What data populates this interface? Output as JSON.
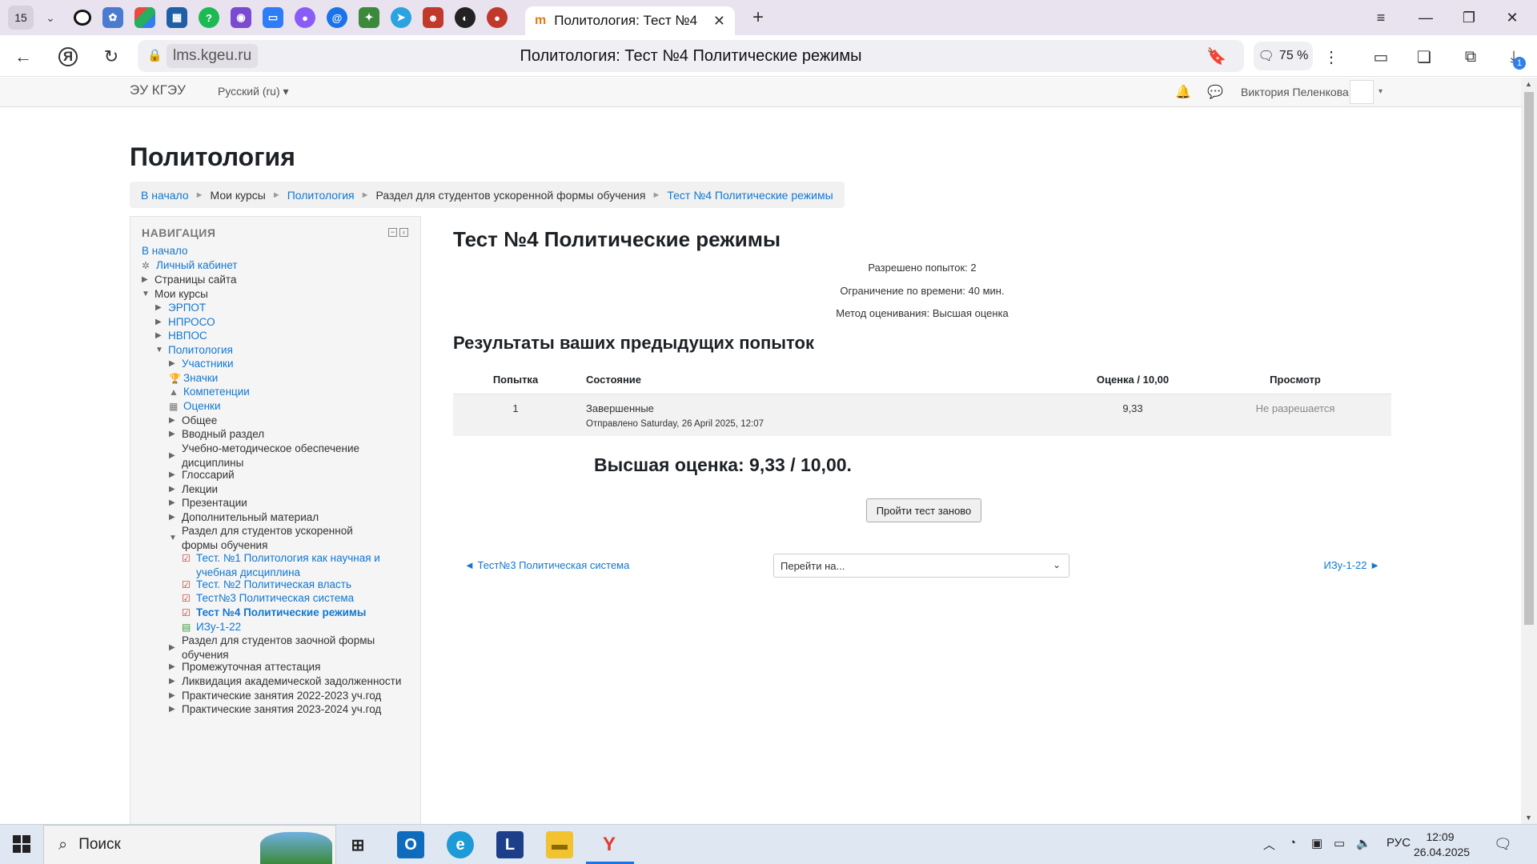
{
  "browser": {
    "tab_count": "15",
    "active_tab_title": "Политология: Тест №4",
    "domain": "lms.kgeu.ru",
    "page_title": "Политология: Тест №4 Политические режимы",
    "zoom": "75 %",
    "download_badge": "1"
  },
  "moodle": {
    "brand": "ЭУ КГЭУ",
    "language": "Русский (ru)",
    "user_name": "Виктория Пеленкова"
  },
  "course_title": "Политология",
  "breadcrumb": [
    "В начало",
    "Мои курсы",
    "Политология",
    "Раздел для студентов ускоренной формы обучения",
    "Тест №4 Политические режимы"
  ],
  "navigation": {
    "heading": "НАВИГАЦИЯ",
    "items": [
      {
        "label": "В начало"
      },
      {
        "label": "Личный кабинет"
      },
      {
        "label": "Страницы сайта"
      },
      {
        "label": "Мои курсы"
      },
      {
        "label": "ЭРПОТ"
      },
      {
        "label": "НПРОСО"
      },
      {
        "label": "НВПОС"
      },
      {
        "label": "Политология"
      },
      {
        "label": "Участники"
      },
      {
        "label": "Значки"
      },
      {
        "label": "Компетенции"
      },
      {
        "label": "Оценки"
      },
      {
        "label": "Общее"
      },
      {
        "label": "Вводный раздел"
      },
      {
        "label": "Учебно-методическое обеспечение дисциплины"
      },
      {
        "label": "Глоссарий"
      },
      {
        "label": "Лекции"
      },
      {
        "label": "Презентации"
      },
      {
        "label": "Дополнительный материал"
      },
      {
        "label": "Раздел для студентов ускоренной формы обучения"
      },
      {
        "label": "Тест. №1 Политология как научная и учебная дисциплина"
      },
      {
        "label": "Тест. №2 Политическая власть"
      },
      {
        "label": "Тест№3 Политическая система"
      },
      {
        "label": "Тест №4 Политические режимы"
      },
      {
        "label": "ИЗу-1-22"
      },
      {
        "label": "Раздел для студентов заочной формы обучения"
      },
      {
        "label": "Промежуточная аттестация"
      },
      {
        "label": "Ликвидация академической задолженности"
      },
      {
        "label": "Практические занятия 2022-2023 уч.год"
      },
      {
        "label": "Практические занятия 2023-2024 уч.год"
      }
    ]
  },
  "quiz": {
    "name": "Тест №4 Политические режимы",
    "info": [
      "Разрешено попыток: 2",
      "Ограничение по времени: 40 мин.",
      "Метод оценивания: Высшая оценка"
    ],
    "previous_heading": "Результаты ваших предыдущих попыток",
    "table_headers": [
      "Попытка",
      "Состояние",
      "Оценка / 10,00",
      "Просмотр"
    ],
    "attempt": {
      "number": "1",
      "state": "Завершенные",
      "submitted": "Отправлено Saturday, 26 April 2025, 12:07",
      "grade": "9,33",
      "review": "Не разрешается"
    },
    "highest_grade": "Высшая оценка: 9,33 / 10,00.",
    "retake_button": "Пройти тест заново",
    "prev_link": "◄ Тест№3 Политическая система",
    "jump_placeholder": "Перейти на...",
    "next_link": "ИЗу-1-22 ►"
  },
  "taskbar": {
    "search_placeholder": "Поиск",
    "language": "РУС",
    "time": "12:09",
    "date": "26.04.2025"
  }
}
